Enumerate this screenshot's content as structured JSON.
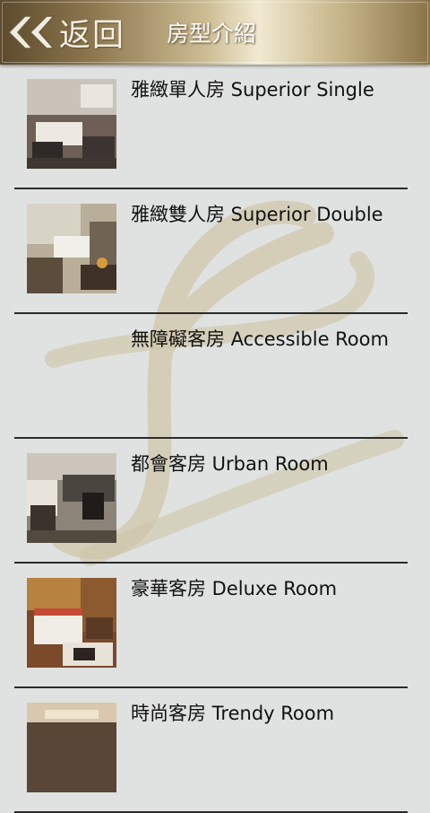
{
  "header": {
    "back_label": "返回",
    "title": "房型介紹"
  },
  "rooms": [
    {
      "name": "雅緻單人房  Superior Single",
      "has_photo": true
    },
    {
      "name": "雅緻雙人房 Superior Double",
      "has_photo": true
    },
    {
      "name": "無障礙客房 Accessible Room",
      "has_photo": false
    },
    {
      "name": "都會客房 Urban Room",
      "has_photo": true
    },
    {
      "name": "豪華客房 Deluxe Room",
      "has_photo": true
    },
    {
      "name": "時尚客房 Trendy Room",
      "has_photo": true
    }
  ],
  "colors": {
    "background": "#dfe2e1",
    "header_gold": "#cdbd94",
    "divider": "#2b2b2b",
    "watermark": "#cfc6a8"
  },
  "icons": {
    "back": "double-chevron-left-icon"
  }
}
